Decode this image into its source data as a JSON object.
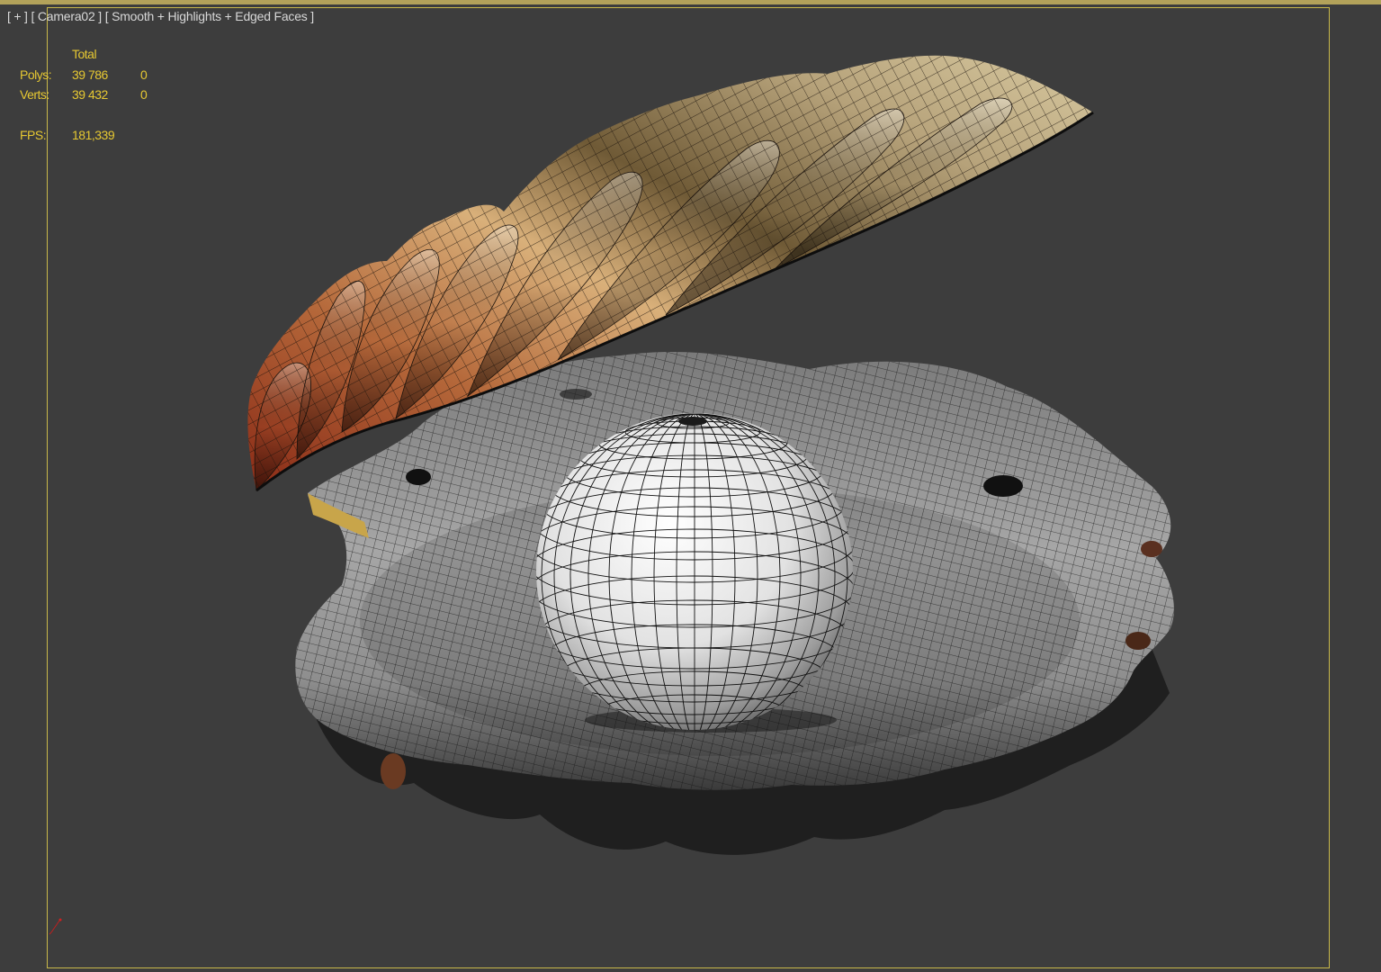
{
  "viewport": {
    "label_plus": "[ + ]",
    "label_camera": "[ Camera02 ]",
    "label_shading": "[ Smooth + Highlights + Edged Faces ]"
  },
  "stats": {
    "header": "Total",
    "polys_label": "Polys:",
    "polys_value": "39 786",
    "polys_selected": "0",
    "verts_label": "Verts:",
    "verts_value": "39 432",
    "verts_selected": "0",
    "fps_label": "FPS:",
    "fps_value": "181,339"
  },
  "scene": {
    "objects": [
      "top-shell",
      "bottom-shell",
      "pearl"
    ],
    "colors": {
      "background": "#3d3d3d",
      "safe_frame": "#c8b84a",
      "stats_text": "#e6c832",
      "label_text": "#d8d8d8"
    }
  }
}
